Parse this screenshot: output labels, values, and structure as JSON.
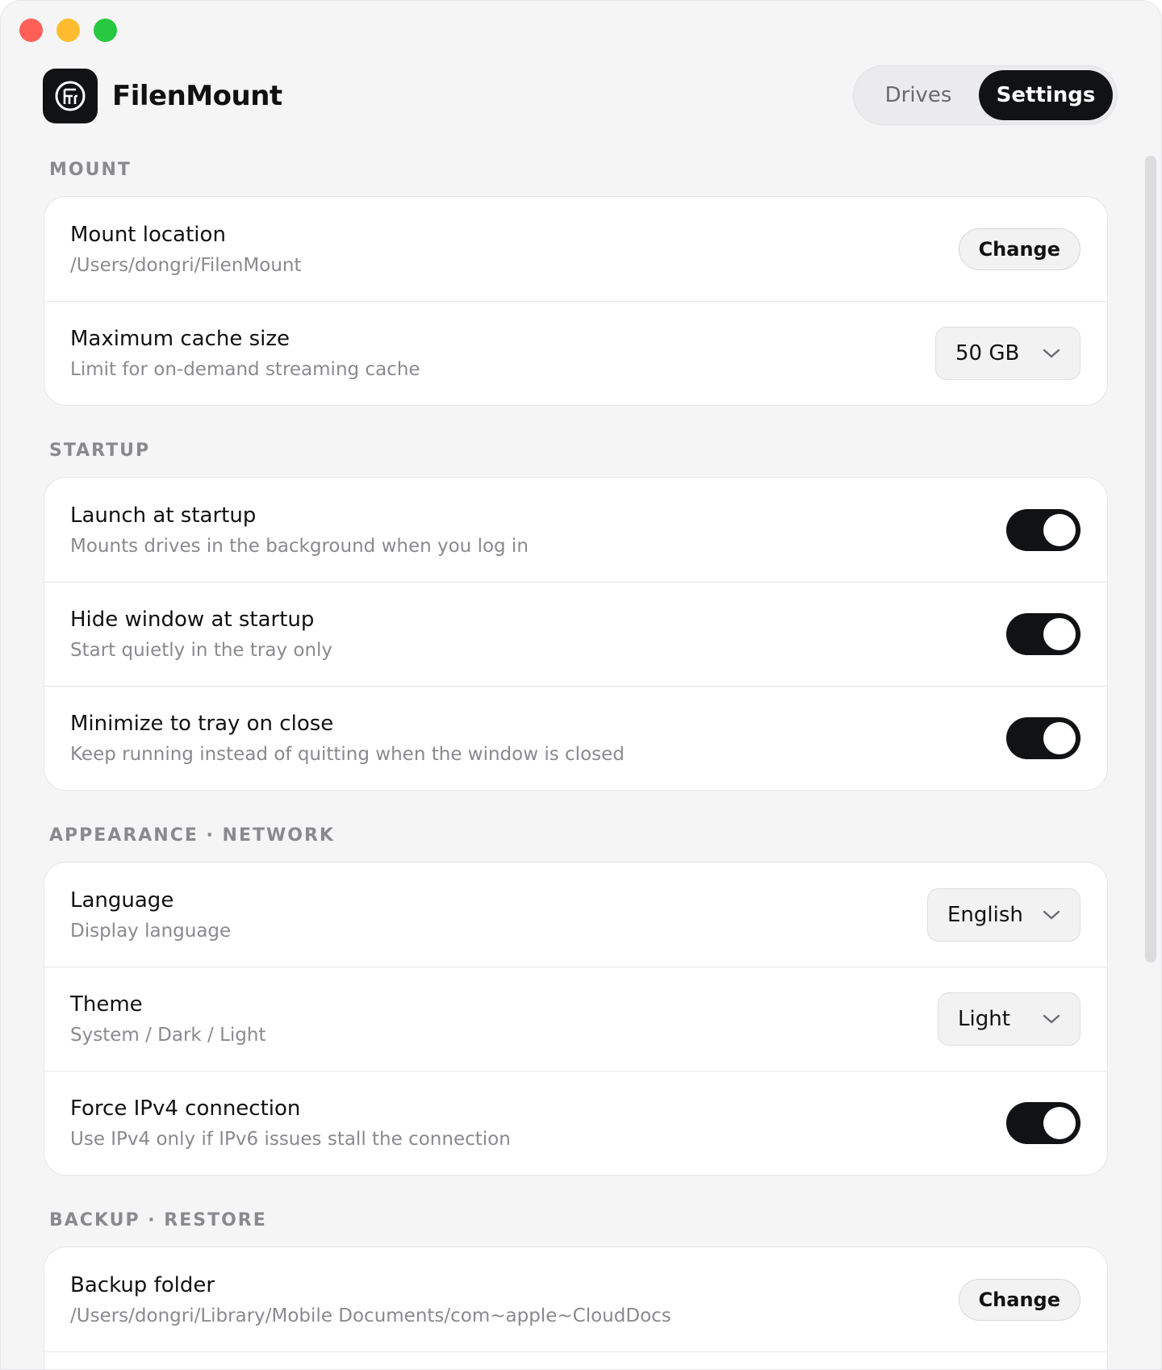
{
  "app": {
    "title": "FilenMount"
  },
  "tabs": [
    {
      "label": "Drives",
      "active": false
    },
    {
      "label": "Settings",
      "active": true
    }
  ],
  "sections": {
    "mount": {
      "title": "MOUNT",
      "rows": {
        "location": {
          "label": "Mount location",
          "desc": "/Users/dongri/FilenMount",
          "button": "Change"
        },
        "cache": {
          "label": "Maximum cache size",
          "desc": "Limit for on-demand streaming cache",
          "value": "50 GB"
        }
      }
    },
    "startup": {
      "title": "STARTUP",
      "rows": {
        "launch": {
          "label": "Launch at startup",
          "desc": "Mounts drives in the background when you log in",
          "on": true
        },
        "hide": {
          "label": "Hide window at startup",
          "desc": "Start quietly in the tray only",
          "on": true
        },
        "minimize": {
          "label": "Minimize to tray on close",
          "desc": "Keep running instead of quitting when the window is closed",
          "on": true
        }
      }
    },
    "appearance": {
      "title": "APPEARANCE · NETWORK",
      "rows": {
        "language": {
          "label": "Language",
          "desc": "Display language",
          "value": "English"
        },
        "theme": {
          "label": "Theme",
          "desc": "System / Dark / Light",
          "value": "Light"
        },
        "ipv4": {
          "label": "Force IPv4 connection",
          "desc": "Use IPv4 only if IPv6 issues stall the connection",
          "on": true
        }
      }
    },
    "backup": {
      "title": "BACKUP · RESTORE",
      "rows": {
        "folder": {
          "label": "Backup folder",
          "desc": "/Users/dongri/Library/Mobile Documents/com~apple~CloudDocs",
          "button": "Change"
        }
      }
    }
  },
  "colors": {
    "accent": "#111214",
    "window_bg": "#f5f5f6",
    "muted": "#8a8a8e"
  }
}
